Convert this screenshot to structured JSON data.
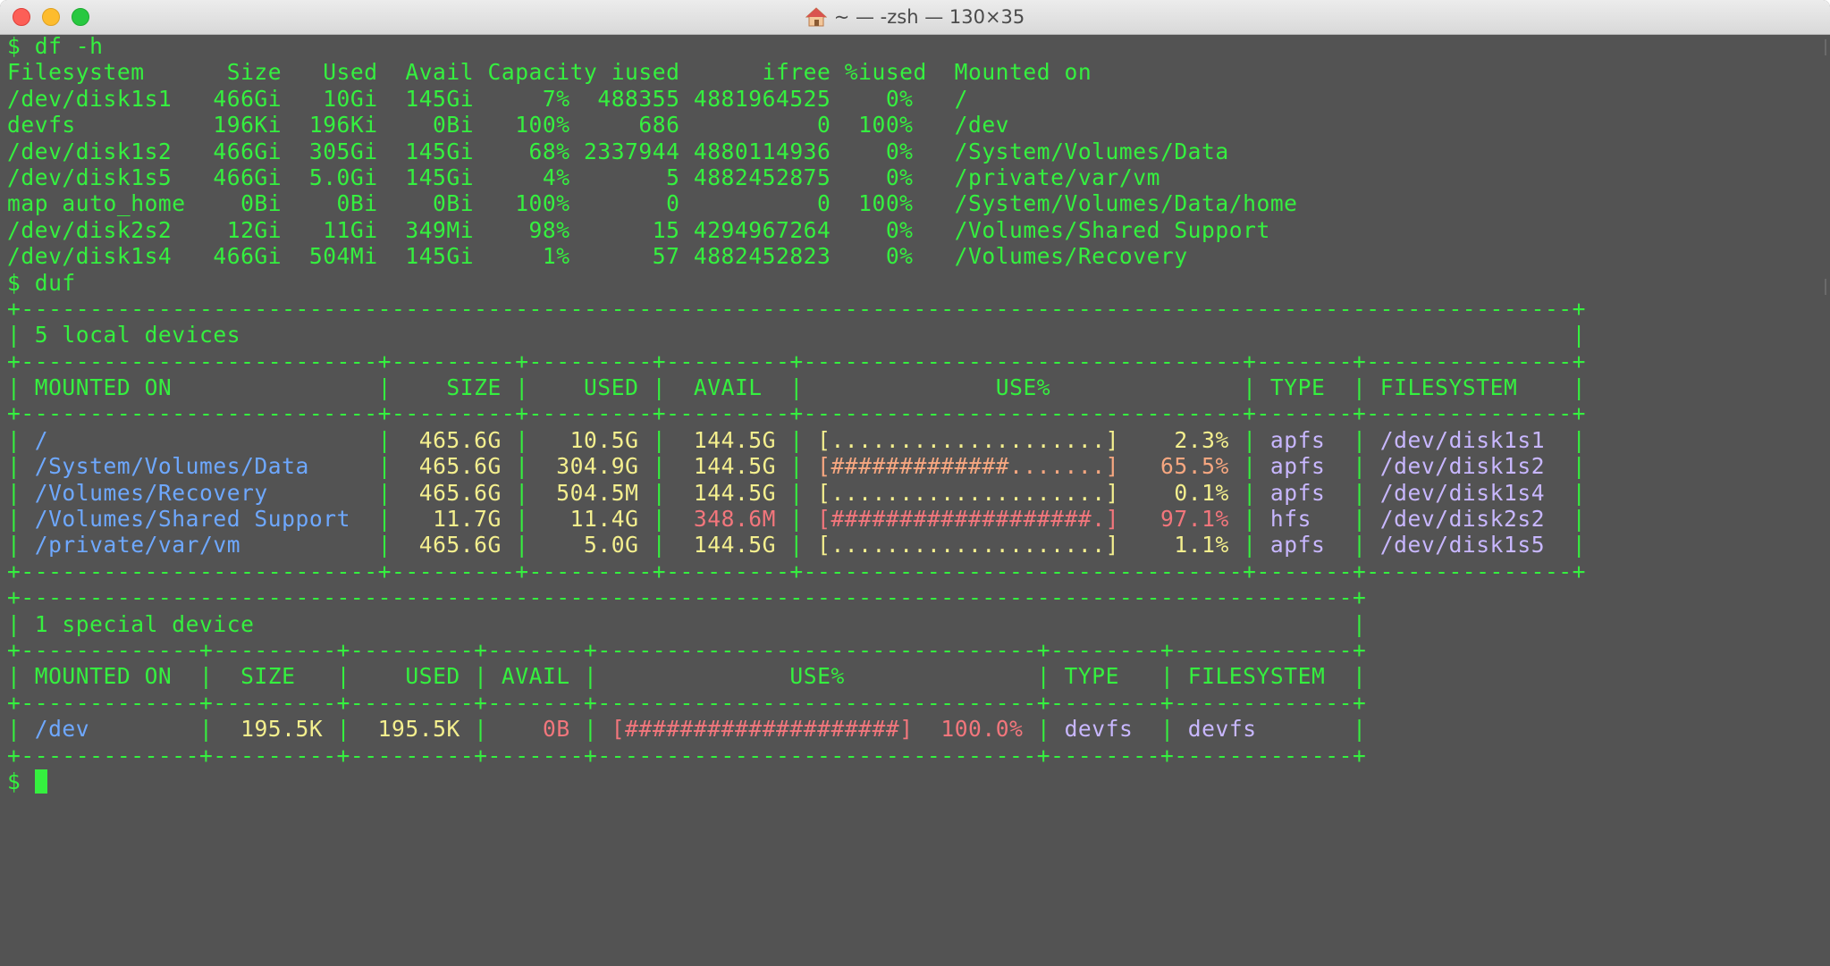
{
  "window": {
    "title": "~ — -zsh — 130×35"
  },
  "colors": {
    "background": "#535353",
    "text_green": "#35f03f",
    "blue": "#6ea8ff",
    "yellow": "#f4ef8e",
    "orange": "#f7a780",
    "red": "#f2767c",
    "lavender": "#c8b7ff"
  },
  "icons": {
    "title_icon": "home-icon",
    "close": "close-button",
    "minimize": "minimize-button",
    "zoom": "zoom-button"
  },
  "prompt": "$ ",
  "df": {
    "command": "df -h",
    "header": "Filesystem      Size   Used  Avail Capacity iused      ifree %iused  Mounted on",
    "rows": [
      "/dev/disk1s1   466Gi   10Gi  145Gi     7%  488355 4881964525    0%   /",
      "devfs          196Ki  196Ki    0Bi   100%     686          0  100%   /dev",
      "/dev/disk1s2   466Gi  305Gi  145Gi    68% 2337944 4880114936    0%   /System/Volumes/Data",
      "/dev/disk1s5   466Gi  5.0Gi  145Gi     4%       5 4882452875    0%   /private/var/vm",
      "map auto_home    0Bi    0Bi    0Bi   100%       0          0  100%   /System/Volumes/Data/home",
      "/dev/disk2s2    12Gi   11Gi  349Mi    98%      15 4294967264    0%   /Volumes/Shared Support",
      "/dev/disk1s4   466Gi  504Mi  145Gi     1%      57 4882452823    0%   /Volumes/Recovery"
    ]
  },
  "duf": {
    "command": "duf",
    "local": {
      "title": "5 local devices",
      "headers": {
        "mounted_on": "MOUNTED ON",
        "size": "SIZE",
        "used": "USED",
        "avail": "AVAIL",
        "use_pct": "USE%",
        "type": "TYPE",
        "filesystem": "FILESYSTEM"
      },
      "rows": [
        {
          "mount": "/",
          "size": "465.6G",
          "used": "10.5G",
          "avail": "144.5G",
          "bar": "[....................]",
          "pct": "2.3%",
          "type": "apfs",
          "fs": "/dev/disk1s1"
        },
        {
          "mount": "/System/Volumes/Data",
          "size": "465.6G",
          "used": "304.9G",
          "avail": "144.5G",
          "bar": "[#############.......]",
          "pct": "65.5%",
          "type": "apfs",
          "fs": "/dev/disk1s2"
        },
        {
          "mount": "/Volumes/Recovery",
          "size": "465.6G",
          "used": "504.5M",
          "avail": "144.5G",
          "bar": "[....................]",
          "pct": "0.1%",
          "type": "apfs",
          "fs": "/dev/disk1s4"
        },
        {
          "mount": "/Volumes/Shared Support",
          "size": "11.7G",
          "used": "11.4G",
          "avail": "348.6M",
          "bar": "[###################.]",
          "pct": "97.1%",
          "type": "hfs",
          "fs": "/dev/disk2s2"
        },
        {
          "mount": "/private/var/vm",
          "size": "465.6G",
          "used": "5.0G",
          "avail": "144.5G",
          "bar": "[....................]",
          "pct": "1.1%",
          "type": "apfs",
          "fs": "/dev/disk1s5"
        }
      ]
    },
    "special": {
      "title": "1 special device",
      "headers": {
        "mounted_on": "MOUNTED ON",
        "size": "SIZE",
        "used": "USED",
        "avail": "AVAIL",
        "use_pct": "USE%",
        "type": "TYPE",
        "filesystem": "FILESYSTEM"
      },
      "rows": [
        {
          "mount": "/dev",
          "size": "195.5K",
          "used": "195.5K",
          "avail": "0B",
          "bar": "[####################]",
          "pct": "100.0%",
          "type": "devfs",
          "fs": "devfs"
        }
      ]
    }
  }
}
